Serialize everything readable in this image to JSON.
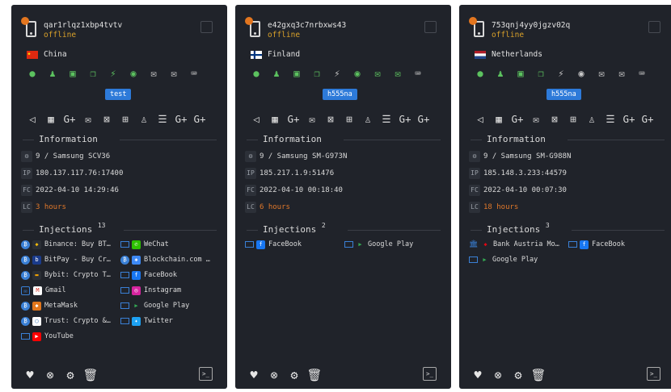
{
  "colors": {
    "card_bg": "#20232a",
    "online_permission": "#5cc25f",
    "status_offline": "#d8a02a",
    "tag": "#2d7ad9",
    "last_connect": "#e0782a"
  },
  "info_labels": {
    "ip": "IP",
    "fc": "FC",
    "lc": "LC"
  },
  "sections": {
    "information": "Information",
    "injections": "Injections"
  },
  "permission_icons": [
    "eye-icon",
    "android-icon",
    "contacts-icon",
    "copy-icon",
    "bolt-icon",
    "location-icon",
    "sms-icon",
    "mail-icon",
    "keyboard-icon"
  ],
  "toolbar_icons": [
    "megaphone-icon",
    "calendar-icon",
    "google-plus-icon",
    "mail-icon",
    "inbox-icon",
    "apps-icon",
    "users-icon",
    "list-icon",
    "google-plus-icon",
    "google-plus-icon"
  ],
  "footer_icons": [
    "heart-icon",
    "cancel-icon",
    "settings-icon",
    "trash-icon",
    "terminal-icon"
  ],
  "terminal_label": ">_",
  "devices": [
    {
      "id": "qar1rlqz1xbp4tvtv",
      "status": "offline",
      "country": "China",
      "tag": "test",
      "android": "9 / Samsung SCV36",
      "ip": "180.137.117.76:17400",
      "fc": "2022-04-10 14:29:46",
      "lc": "3 hours",
      "injection_count": "13",
      "injections": [
        {
          "name": "Binance: Buy BT…",
          "type": "circle",
          "color": "#f0b90b"
        },
        {
          "name": "WeChat",
          "type": "square",
          "color": "#2dc100"
        },
        {
          "name": "BitPay - Buy Cr…",
          "type": "circle",
          "color": "#1a3b8b"
        },
        {
          "name": "Blockchain.com …",
          "type": "circle",
          "color": "#3d89f5"
        },
        {
          "name": "Bybit: Crypto T…",
          "type": "circle",
          "color": "#2b2f36"
        },
        {
          "name": "FaceBook",
          "type": "square",
          "color": "#1877f2"
        },
        {
          "name": "Gmail",
          "type": "mail",
          "color": "#ffffff"
        },
        {
          "name": "Instagram",
          "type": "square",
          "color": "#d6249f"
        },
        {
          "name": "MetaMask",
          "type": "circle",
          "color": "#e2761b"
        },
        {
          "name": "Google Play",
          "type": "square",
          "color": "#34a853"
        },
        {
          "name": "Trust: Crypto &…",
          "type": "circle",
          "color": "#ffffff"
        },
        {
          "name": "Twitter",
          "type": "square",
          "color": "#1da1f2"
        },
        {
          "name": "YouTube",
          "type": "square",
          "color": "#ff0000"
        }
      ]
    },
    {
      "id": "e42gxq3c7nrbxws43",
      "status": "offline",
      "country": "Finland",
      "tag": "h555na",
      "android": "9 / Samsung SM-G973N",
      "ip": "185.217.1.9:51476",
      "fc": "2022-04-10 00:18:40",
      "lc": "6 hours",
      "injection_count": "2",
      "injections": [
        {
          "name": "FaceBook",
          "type": "square",
          "color": "#1877f2"
        },
        {
          "name": "Google Play",
          "type": "square",
          "color": "#34a853"
        }
      ]
    },
    {
      "id": "753qnj4yy0jgzv02q",
      "status": "offline",
      "country": "Netherlands",
      "tag": "h555na",
      "android": "9 / Samsung SM-G988N",
      "ip": "185.148.3.233:44579",
      "fc": "2022-04-10 00:07:30",
      "lc": "18 hours",
      "injection_count": "3",
      "injections": [
        {
          "name": "Bank Austria Mo…",
          "type": "bank",
          "color": "#e30613"
        },
        {
          "name": "FaceBook",
          "type": "square",
          "color": "#1877f2"
        },
        {
          "name": "Google Play",
          "type": "square",
          "color": "#34a853"
        }
      ]
    }
  ]
}
